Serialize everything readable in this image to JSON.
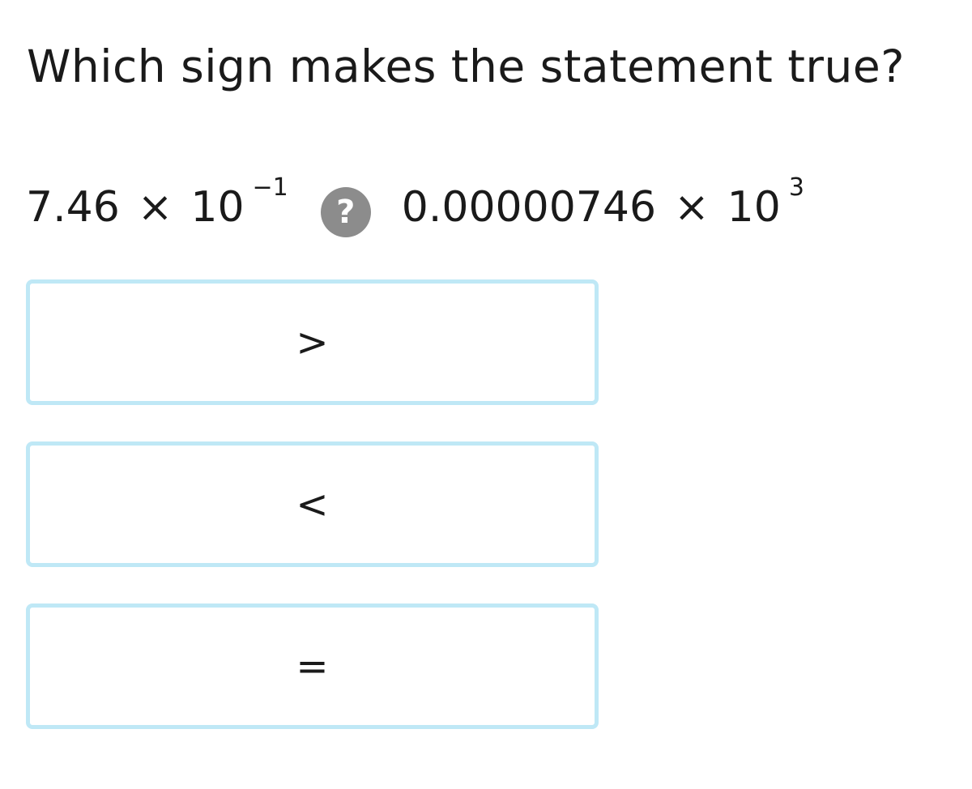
{
  "question": {
    "text": "Which sign makes the statement true?"
  },
  "expression": {
    "left": {
      "coefficient": "7.46",
      "times": "×",
      "base": "10",
      "exponent": "−1"
    },
    "unknown_symbol": "?",
    "right": {
      "coefficient": "0.00000746",
      "times": "×",
      "base": "10",
      "exponent": "3"
    }
  },
  "choices": [
    {
      "label": ">"
    },
    {
      "label": "<"
    },
    {
      "label": "="
    }
  ],
  "colors": {
    "choice_border": "#bfe8f6",
    "unknown_badge": "#8c8c8c",
    "text": "#1a1a1a"
  }
}
